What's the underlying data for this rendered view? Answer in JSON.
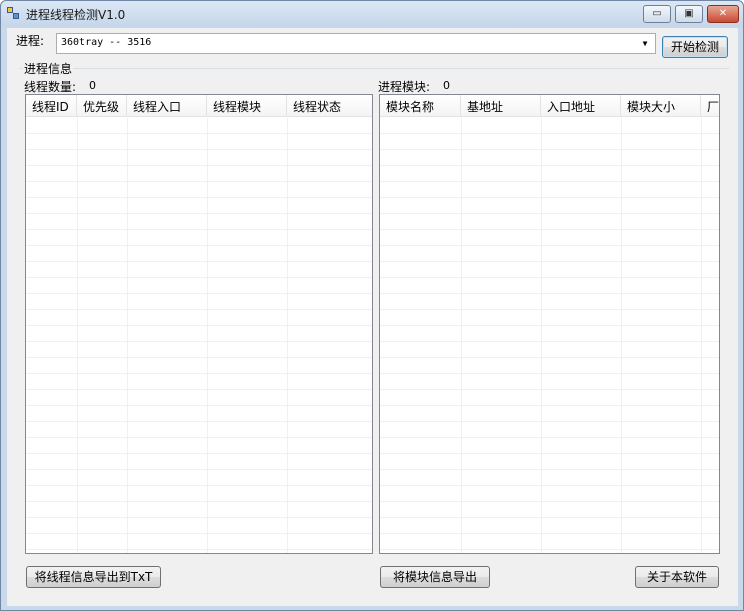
{
  "window": {
    "title": "进程线程检测V1.0",
    "min_glyph": "▭",
    "max_glyph": "▣",
    "close_glyph": "✕"
  },
  "process": {
    "label": "进程:",
    "selected": "360tray -- 3516",
    "arrow": "▼",
    "start_button": "开始检测"
  },
  "group": {
    "title": "进程信息"
  },
  "threads": {
    "count_label": "线程数量:",
    "count_value": "0",
    "columns": [
      "线程ID",
      "优先级",
      "线程入口",
      "线程模块",
      "线程状态"
    ],
    "export_button": "将线程信息导出到TxT"
  },
  "modules": {
    "count_label": "进程模块:",
    "count_value": "0",
    "columns": [
      "模块名称",
      "基地址",
      "入口地址",
      "模块大小",
      "厂"
    ],
    "export_button": "将模块信息导出"
  },
  "about_button": "关于本软件",
  "icons": [
    "app-icon",
    "minimize-icon",
    "maximize-icon",
    "close-icon",
    "dropdown-arrow-icon"
  ]
}
